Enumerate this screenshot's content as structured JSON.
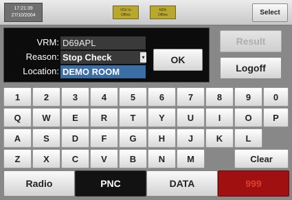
{
  "status": {
    "time": "17:21:39",
    "date": "27/10/2004",
    "vdu_lamp": [
      "VDU In",
      "Offline"
    ],
    "mdk_lamp": [
      "MDK",
      "Offline"
    ],
    "select_label": "Select"
  },
  "form": {
    "vrm_label": "VRM:",
    "vrm_value": "D69APL",
    "reason_label": "Reason:",
    "reason_value": "Stop Check",
    "location_label": "Location:",
    "location_value": "DEMO ROOM",
    "ok_label": "OK",
    "result_label": "Result",
    "logoff_label": "Logoff"
  },
  "keyboard": {
    "row1": [
      "1",
      "2",
      "3",
      "4",
      "5",
      "6",
      "7",
      "8",
      "9",
      "0"
    ],
    "row2": [
      "Q",
      "W",
      "E",
      "R",
      "T",
      "Y",
      "U",
      "I",
      "O",
      "P"
    ],
    "row3": [
      "A",
      "S",
      "D",
      "F",
      "G",
      "H",
      "J",
      "K",
      "L"
    ],
    "row4": [
      "Z",
      "X",
      "C",
      "V",
      "B",
      "N",
      "M"
    ],
    "clear_label": "Clear"
  },
  "function_keys": {
    "radio": "Radio",
    "pnc": "PNC",
    "data": "DATA",
    "emergency": "999"
  },
  "colors": {
    "emergency_bg": "#a01010",
    "location_highlight": "#3a6ea5",
    "status_lamp": "#b9a830"
  }
}
